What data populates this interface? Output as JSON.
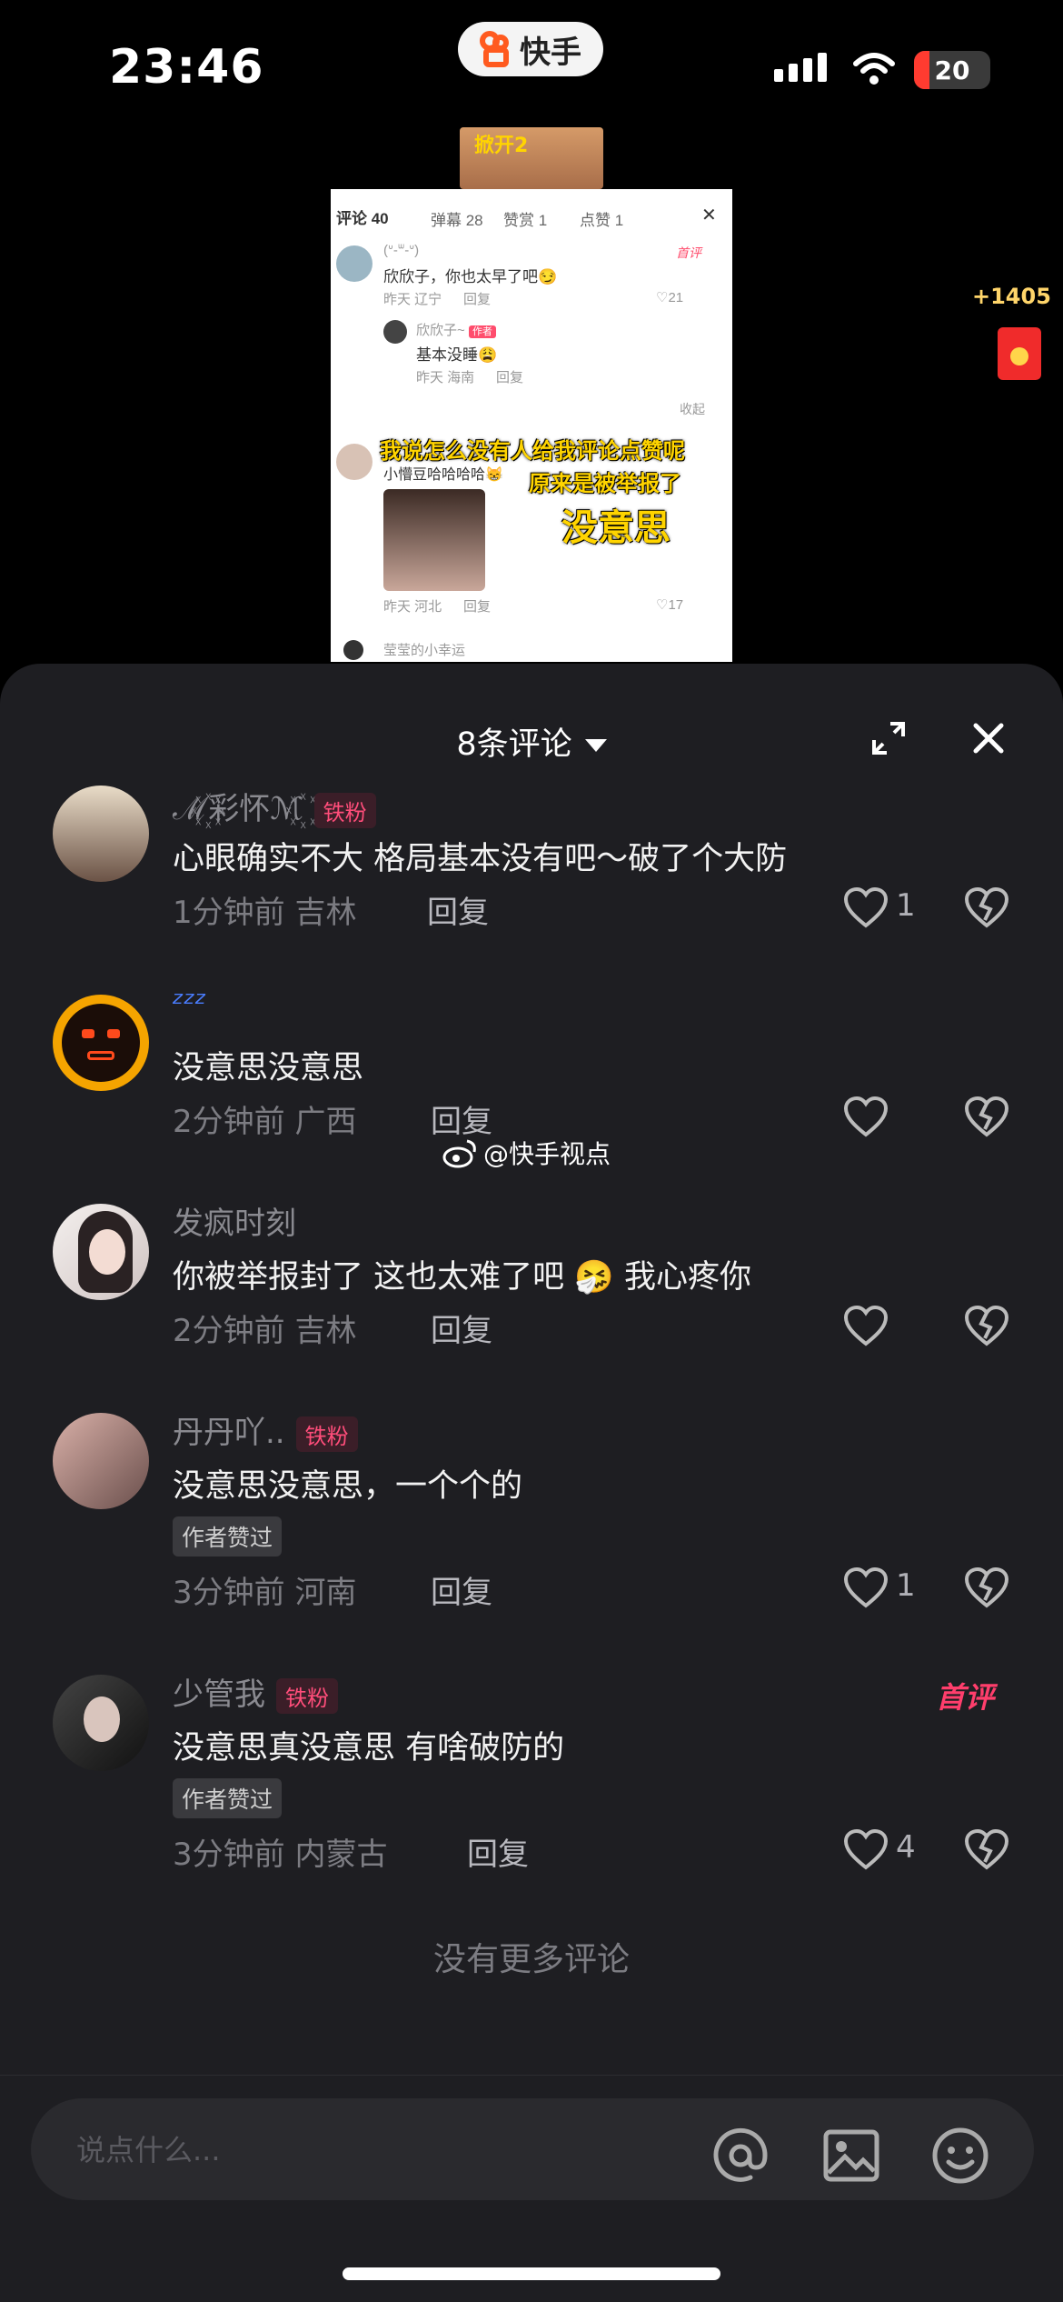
{
  "status_bar": {
    "time": "23:46",
    "app_name": "快手",
    "battery": "20",
    "battery_fraction": 0.2
  },
  "video": {
    "top_caption": "掀开2",
    "shot": {
      "tabs": [
        "评论 40",
        "弹幕 28",
        "赞赏 1",
        "点赞 1"
      ],
      "c1_name": "(ᐡ-ᐜ-ᐡ)",
      "c1_text": "欣欣子，你也太早了吧😏",
      "c1_meta": "昨天 辽宁",
      "c1_reply": "回复",
      "c1_likes": "21",
      "c1_first": "首评",
      "r1_name": "欣欣子~",
      "r1_tag": "作者",
      "r1_text": "基本没睡😩",
      "r1_meta": "昨天 海南",
      "r1_reply": "回复",
      "collapse": "收起",
      "c2_name": "小懵豆哈哈哈哈😸",
      "c2_meta": "昨天 河北",
      "c2_reply": "回复",
      "c2_likes": "17",
      "c3_name": "莹莹的小幸运",
      "overlay_1": "我说怎么没有人给我评论点赞呢",
      "overlay_2": "原来是被举报了",
      "overlay_3": "没意思"
    },
    "coin_count": "+1405"
  },
  "panel": {
    "title": "8条评论",
    "comments": [
      {
        "name": "ℳ꙰彩怀ℳ꙰",
        "badge": "铁粉",
        "text": "心眼确实不大 格局基本没有吧～破了个大防",
        "meta": "1分钟前 吉林",
        "reply": "回复",
        "likes": "1"
      },
      {
        "name": "ᶻᶻᶻ",
        "badge": "",
        "text": "没意思没意思",
        "meta": "2分钟前 广西",
        "reply": "回复",
        "likes": ""
      },
      {
        "name": "发疯时刻",
        "badge": "",
        "text": "你被举报封了  这也太难了吧 🤧 我心疼你",
        "meta": "2分钟前 吉林",
        "reply": "回复",
        "likes": ""
      },
      {
        "name": "丹丹吖..",
        "badge": "铁粉",
        "text": "没意思没意思，一个个的",
        "liked": "作者赞过",
        "meta": "3分钟前 河南",
        "reply": "回复",
        "likes": "1"
      },
      {
        "name": "少管我",
        "badge": "铁粉",
        "text": "没意思真没意思 有啥破防的",
        "liked": "作者赞过",
        "meta": "3分钟前 内蒙古",
        "reply": "回复",
        "likes": "4",
        "first": "首评"
      }
    ],
    "no_more": "没有更多评论",
    "input_placeholder": "说点什么..."
  },
  "watermark": "@快手视点",
  "colors": {
    "panel_bg": "#1e1e22",
    "accent_pink": "#ff4d7a",
    "gold": "#ffd400"
  }
}
